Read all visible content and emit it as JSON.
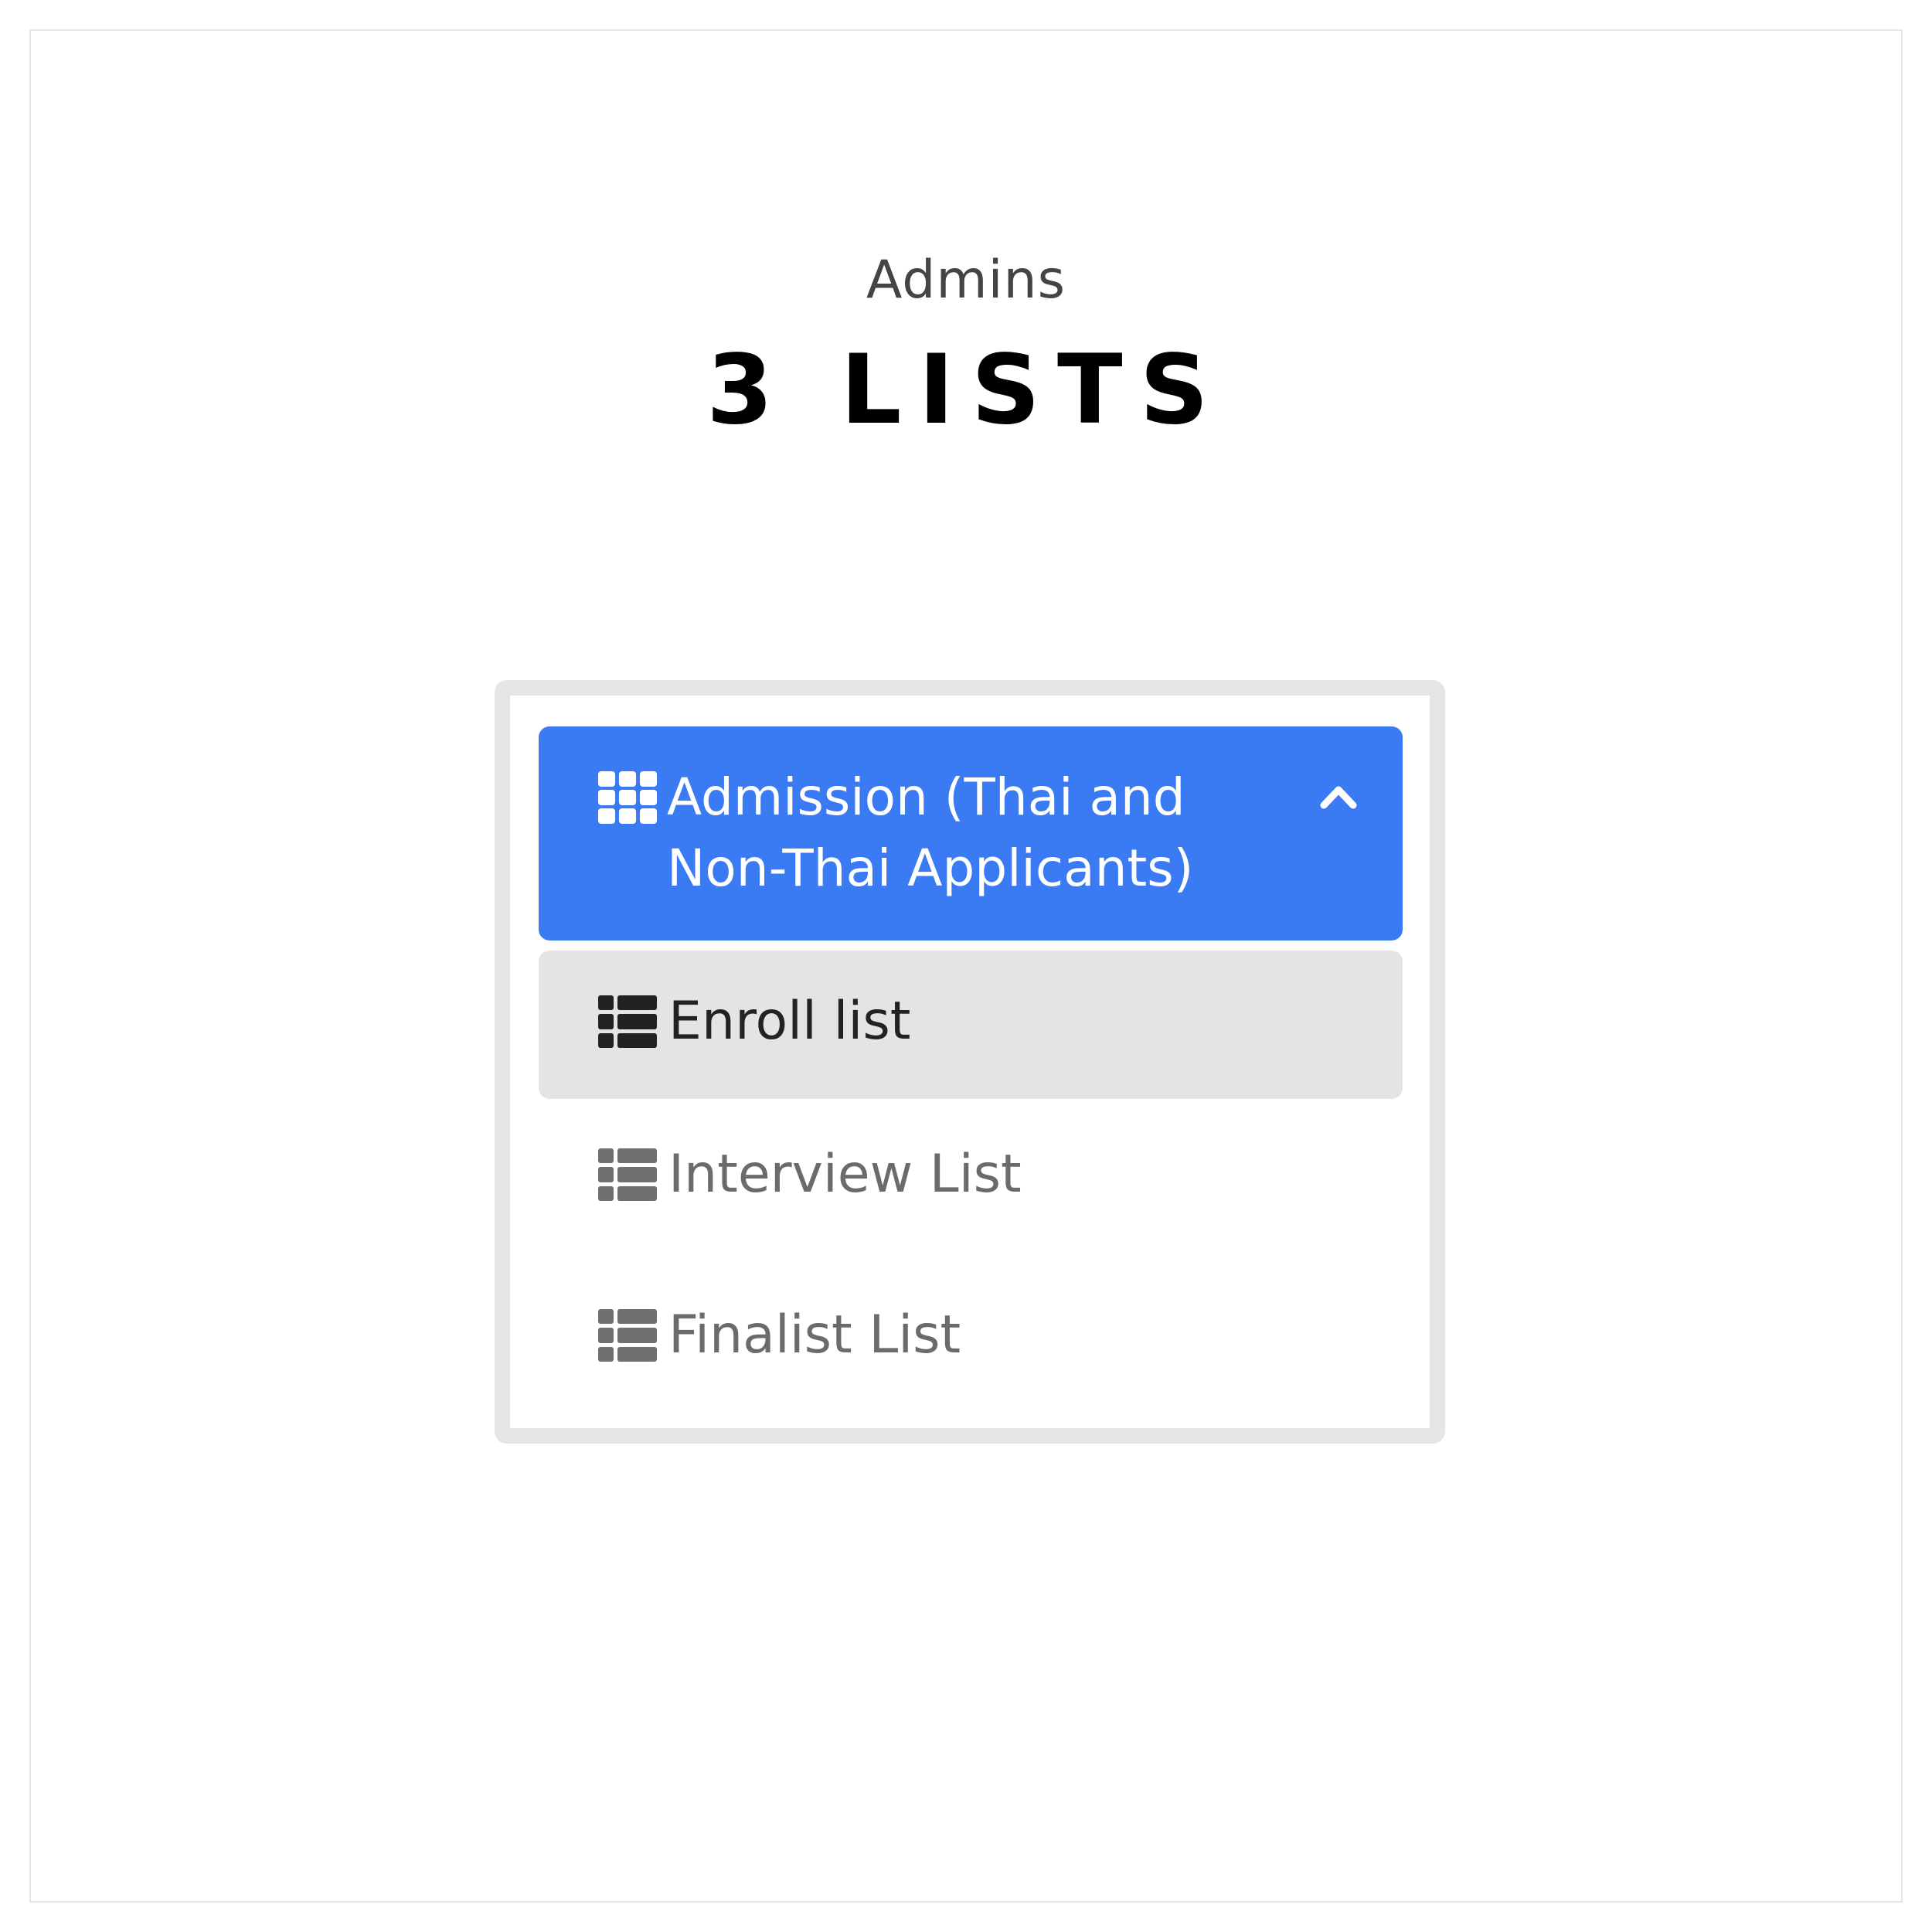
{
  "header": {
    "subtitle": "Admins",
    "headline": "3 LISTS"
  },
  "menu": {
    "section": {
      "title": "Admission (Thai and Non-Thai Applicants)",
      "icon": "grid-icon",
      "toggle_icon": "chevron-up-icon",
      "expanded": true
    },
    "items": [
      {
        "label": "Enroll list",
        "icon": "list-icon",
        "active": true
      },
      {
        "label": "Interview List",
        "icon": "list-icon",
        "active": false
      },
      {
        "label": "Finalist List",
        "icon": "list-icon",
        "active": false
      }
    ]
  },
  "colors": {
    "section_bg": "#3a7bf4",
    "active_item_bg": "#e4e4e4",
    "panel_border": "#e5e5e7",
    "inactive_text": "#6b6b6b",
    "active_text": "#222222"
  }
}
